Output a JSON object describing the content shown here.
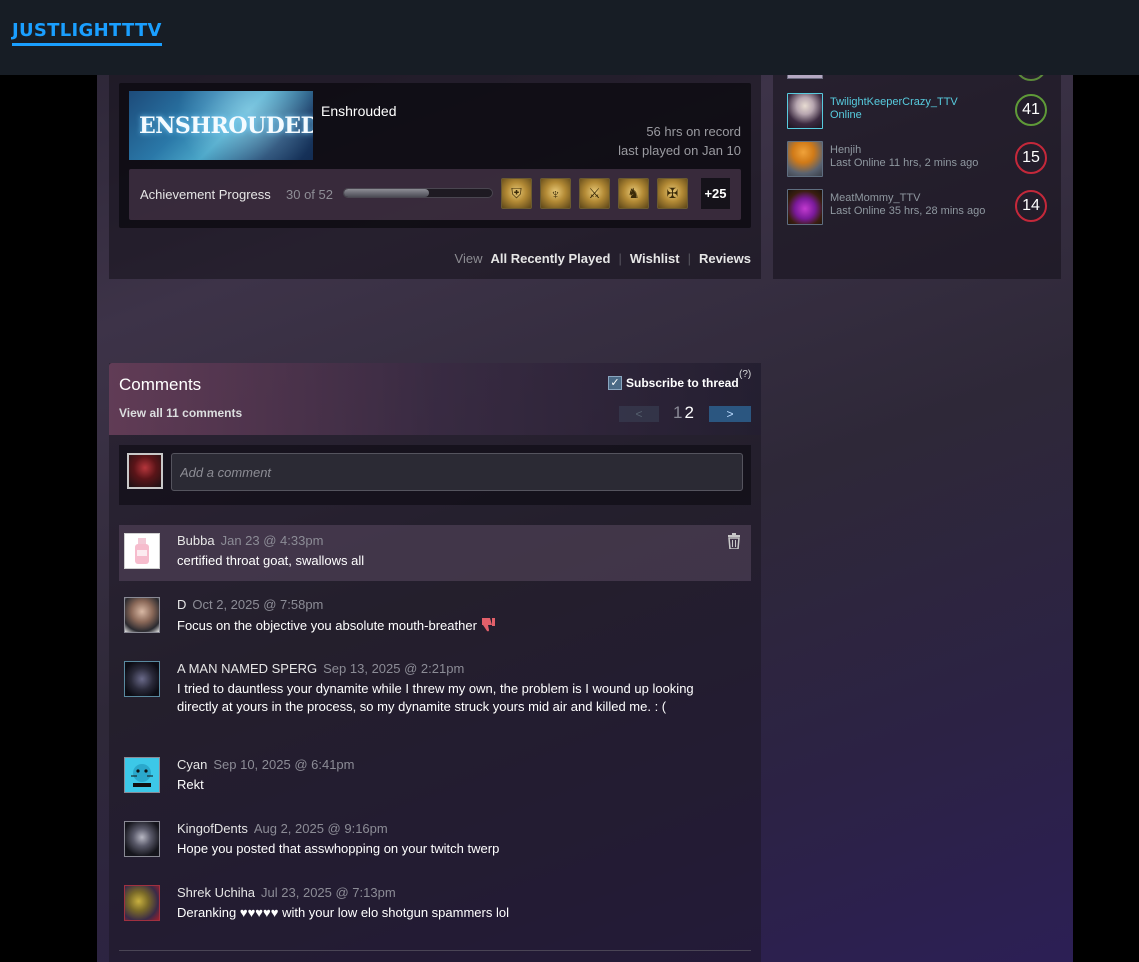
{
  "header": {
    "brand": "JUSTLIGHTTTV",
    "brand_color": "#1a9fff"
  },
  "recent_game": {
    "capsule_text": "ENSHROUDED",
    "name": "Enshrouded",
    "hours": "56 hrs on record",
    "last_played": "last played on Jan 10",
    "achievements": {
      "label": "Achievement Progress",
      "count": "30 of 52",
      "progress_fraction": 0.577,
      "icons": [
        "helmet-achievement-icon",
        "trident-achievement-icon",
        "blade-achievement-icon",
        "knight-achievement-icon",
        "crest-achievement-icon"
      ],
      "more": "+25"
    },
    "view": {
      "label": "View",
      "links": [
        "All Recently Played",
        "Wishlist",
        "Reviews"
      ]
    }
  },
  "friends": [
    {
      "name": "TwilightKeeperCrazy_TTV",
      "status": "Online",
      "level": "41",
      "online": true,
      "level_color": "#5f9a38"
    },
    {
      "name": "Henjih",
      "status": "Last Online 11 hrs, 2 mins ago",
      "level": "15",
      "online": false,
      "level_color": "#c4283a"
    },
    {
      "name": "MeatMommy_TTV",
      "status": "Last Online 35 hrs, 28 mins ago",
      "level": "14",
      "online": false,
      "level_color": "#c4283a"
    }
  ],
  "comments": {
    "title": "Comments",
    "view_all": "View all 11 comments",
    "subscribe": "Subscribe to thread",
    "help": "(?)",
    "pagination": {
      "prev": "<",
      "pages": [
        "1",
        "2"
      ],
      "current": "2",
      "next": ">"
    },
    "compose_placeholder": "Add a comment",
    "items": [
      {
        "author": "Bubba",
        "date": "Jan 23 @ 4:33pm",
        "text": "certified throat goat, swallows all",
        "highlighted": true
      },
      {
        "author": "D",
        "date": "Oct 2, 2025 @ 7:58pm",
        "text": "Focus on the objective you absolute mouth-breather"
      },
      {
        "author": "A MAN NAMED SPERG",
        "date": "Sep 13, 2025 @ 2:21pm",
        "text": "I tried to dauntless your dynamite while I threw my own, the problem is I wound up looking directly at yours in the process, so my dynamite struck yours mid air and killed me. : ("
      },
      {
        "author": "Cyan",
        "date": "Sep 10, 2025 @ 6:41pm",
        "text": "Rekt"
      },
      {
        "author": "KingofDents",
        "date": "Aug 2, 2025 @ 9:16pm",
        "text": "Hope you posted that asswhopping on your twitch twerp"
      },
      {
        "author": "Shrek Uchiha",
        "date": "Jul 23, 2025 @ 7:13pm",
        "text": "Deranking ♥♥♥♥♥ with your low elo shotgun spammers lol"
      }
    ]
  }
}
